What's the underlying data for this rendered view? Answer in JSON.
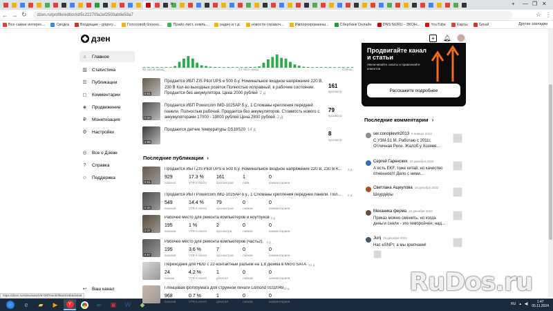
{
  "browser": {
    "url": "dzen.ru/profile/editor/id/5c22270fa2ef2500ab9e53a7",
    "tab_close": "×",
    "new_tab": "+",
    "window_controls": [
      "—",
      "❐",
      "✕"
    ],
    "bookmarks": [
      {
        "label": "Все самое интерес...",
        "color": "#e34234"
      },
      {
        "label": "Сводка",
        "color": "#4285f4"
      },
      {
        "label": "Входящие - grigory...",
        "color": "#d93025"
      },
      {
        "label": "Голосовой блокно...",
        "color": "#f2b400"
      },
      {
        "label": "Прайс-лист. компь...",
        "color": "#4caf50"
      },
      {
        "label": "радио и т.д.",
        "color": "#f2b400"
      },
      {
        "label": "новости справоч...",
        "color": "#f2b400"
      },
      {
        "label": "Импортированны...",
        "color": "#f2b400"
      },
      {
        "label": "Сбербанк Онлайн",
        "color": "#21a038"
      },
      {
        "label": "DNS:NURU - ЭКОН...",
        "color": "#c00"
      },
      {
        "label": "YouTube",
        "color": "#ff0000"
      },
      {
        "label": "Карты",
        "color": "#e34234"
      },
      {
        "label": "Gmail",
        "color": "#d93025"
      }
    ],
    "other_bookmarks": "Другие закладки",
    "status_link": "https://dzen.ru/video/watch/6729f7eecb0f8a4034b6cb0a8"
  },
  "header": {
    "logo": "дзен",
    "icons": [
      "plus-icon",
      "bell-icon"
    ]
  },
  "sidebar": {
    "items": [
      {
        "label": "Главное",
        "icon": "home-icon",
        "glyph": "⌂"
      },
      {
        "label": "Статистика",
        "icon": "stats-icon",
        "glyph": "▥"
      },
      {
        "label": "Публикации",
        "icon": "publications-icon",
        "glyph": "☰"
      },
      {
        "label": "Комментарии",
        "icon": "comments-icon",
        "glyph": "◻"
      },
      {
        "label": "Продвижение",
        "icon": "promotion-icon",
        "glyph": "◈"
      },
      {
        "label": "Монетизация",
        "icon": "money-icon",
        "glyph": "₽"
      },
      {
        "label": "Настройки",
        "icon": "gear-icon",
        "glyph": "⚙"
      },
      {
        "label": "Все о Дзене",
        "icon": "info-icon",
        "glyph": "◎"
      },
      {
        "label": "Справка",
        "icon": "help-icon",
        "glyph": "?"
      },
      {
        "label": "Поддержка",
        "icon": "support-icon",
        "glyph": "☺"
      }
    ],
    "channel": "Ваш канал"
  },
  "chart": {
    "labels": [
      "48 часов назад",
      "24 часа назад",
      "Сейчас"
    ],
    "bar_color": "#2fa84f",
    "values": [
      0.02,
      0.02,
      0.03,
      0.03,
      0.02,
      0.02,
      0.03,
      0.1,
      0.35,
      0.55,
      0.7,
      0.55,
      0.3,
      0.15,
      0.1,
      0.06,
      0.04,
      0.03,
      0.02,
      0.02,
      0.02,
      0.02,
      0.03,
      0.04,
      0.04,
      0.05,
      0.08,
      0.3,
      0.5,
      0.65,
      0.8,
      0.6,
      0.55,
      0.35,
      0.2,
      0.12,
      0.06,
      0.04,
      0.03,
      0.03,
      0.02,
      0.02,
      0.02,
      0.02,
      0.02,
      0.03,
      0.02,
      0.02
    ]
  },
  "top_publications": [
    {
      "duration": "0:51",
      "text": "Продается ИБП ZIS Pilot UPS e 500 б.у. Номинальное входное напряжение 220 В, 230 В Кол-во выходных розеток Полностью исправный, в рабочем состоянии. Продается без аккумулятора. Цена 2000 рублей",
      "date": "2 д",
      "views": "161",
      "views_label": "просмотр"
    },
    {
      "duration": "0:33",
      "text": "Продается ИБП Powercom IMD-1025AP б.у., 1 Сломаны крепления передней панели. Полностью рабочий. Продается без аккумуляторов. Стоимость нового с аккумуляторами 17000 - 19000 рублей Цена 2800 рублей",
      "date": "2 д",
      "views": "79",
      "views_label": "просмотр"
    },
    {
      "duration": "2:59",
      "text": "Продаются датчик температуры DS18S20",
      "date": "14 д",
      "views": "8",
      "views_label": "просмотр"
    }
  ],
  "recent": {
    "title": "Последние публикации",
    "arrow": "›",
    "stat_labels": [
      "показов",
      "VTR в ленте",
      "просмотров",
      "лайк",
      "комментариев"
    ],
    "items": [
      {
        "duration": "0:51",
        "title": "Продается ИБП ZIS Pilot UPS e 500 б.у. Номинальное входное напряжение 220 В, 230 В К...",
        "date": "2 д",
        "stats": [
          "929",
          "17.3 %",
          "161",
          "1",
          "0"
        ],
        "labels": [
          "показов",
          "VTR в ленте",
          "просмотров",
          "лайк",
          "комментариев"
        ]
      },
      {
        "duration": "0:33",
        "title": "Продается ИБП Powercom IMD-1025AP б.у., 1 Сломаны крепления передней панели. Пол...",
        "date": "2 д",
        "stats": [
          "549",
          "14.4 %",
          "79",
          "0",
          "0"
        ],
        "labels": [
          "показов",
          "VTR в ленте",
          "просмотров",
          "лайков",
          "комментариев"
        ]
      },
      {
        "duration": "0:37",
        "title": "Рабочее место для ремонта компьютеров и ноутбуков",
        "date": "4 д",
        "stats": [
          "195",
          "1 %",
          "2",
          "0",
          "0"
        ],
        "labels": [
          "показов",
          "VTR в ленте",
          "просмотра",
          "лайков",
          "комментариев"
        ]
      },
      {
        "duration": "0:57",
        "title": "Рабочее место для ремонта компьютеров (часть2).",
        "date": "4 д",
        "stats": [
          "195",
          "3.6 %",
          "7",
          "0",
          "0"
        ],
        "labels": [
          "показов",
          "VTR в ленте",
          "просмотров",
          "лайков",
          "комментариев"
        ]
      },
      {
        "duration": "",
        "title": "Переходник для HDD с 22-контактный разъем на 1,8 дюйма в Micro SATA",
        "date": "10 д",
        "stats": [
          "24",
          "4.2 %",
          "1",
          "0",
          "0"
        ],
        "labels": [
          "показа",
          "VTR в ленте",
          "дочитал",
          "лайков",
          "комментариев"
        ]
      },
      {
        "duration": "",
        "title": "Глянцевая фотобумага для струйной печати Lomond 0102049",
        "date": "10 д",
        "stats": [
          "968",
          "0.7 %",
          "1",
          "0",
          "0"
        ],
        "labels": [
          "показов",
          "VTR в ленте",
          "дочитал",
          "лайков",
          "комментариев"
        ]
      }
    ]
  },
  "promo": {
    "title": "Продвигайте канал и статьи",
    "subtitle": "Увеличивайте охваты и привлекайте клиентов",
    "button": "Расскажите подробнее"
  },
  "comments": {
    "title": "Последние комментарии",
    "arrow": "›",
    "items": [
      {
        "author": "ser.conoplevm2013",
        "date": "9 января 2023",
        "text": "С УЗМ-51 М. Работаю с 2011г. Отличная Реле. Жалоб у Хозяев...",
        "avatar_color": "#8d8d8d"
      },
      {
        "author": "Сергей Гаренских",
        "date": "28 декабря 2022",
        "text": "А есть EKF. тоже китай, но качество отменное!!! Дело с ними...",
        "avatar_color": "#3b6ea5"
      },
      {
        "author": "Светлана Ащеулова",
        "date": "18 декабря 2022",
        "text": "Шкурдёры",
        "avatar_color": "#a0522d"
      },
      {
        "author": "Механика ферма",
        "date": "16 декабря 2022",
        "text": "Приказ можно сменить, но когда деньги сняли - это геморойчен, над...",
        "avatar_color": "#6b4f3a"
      },
      {
        "author": "Jurij",
        "date": "15 декабря 2022",
        "text": "Нас eSNPт, а мы крепчаем!",
        "avatar_color": "#4a5a6a"
      }
    ]
  },
  "taskbar": {
    "lang": "RU",
    "time": "1:47",
    "date": "05.11.2024"
  },
  "watermark": "RuDos.ru"
}
